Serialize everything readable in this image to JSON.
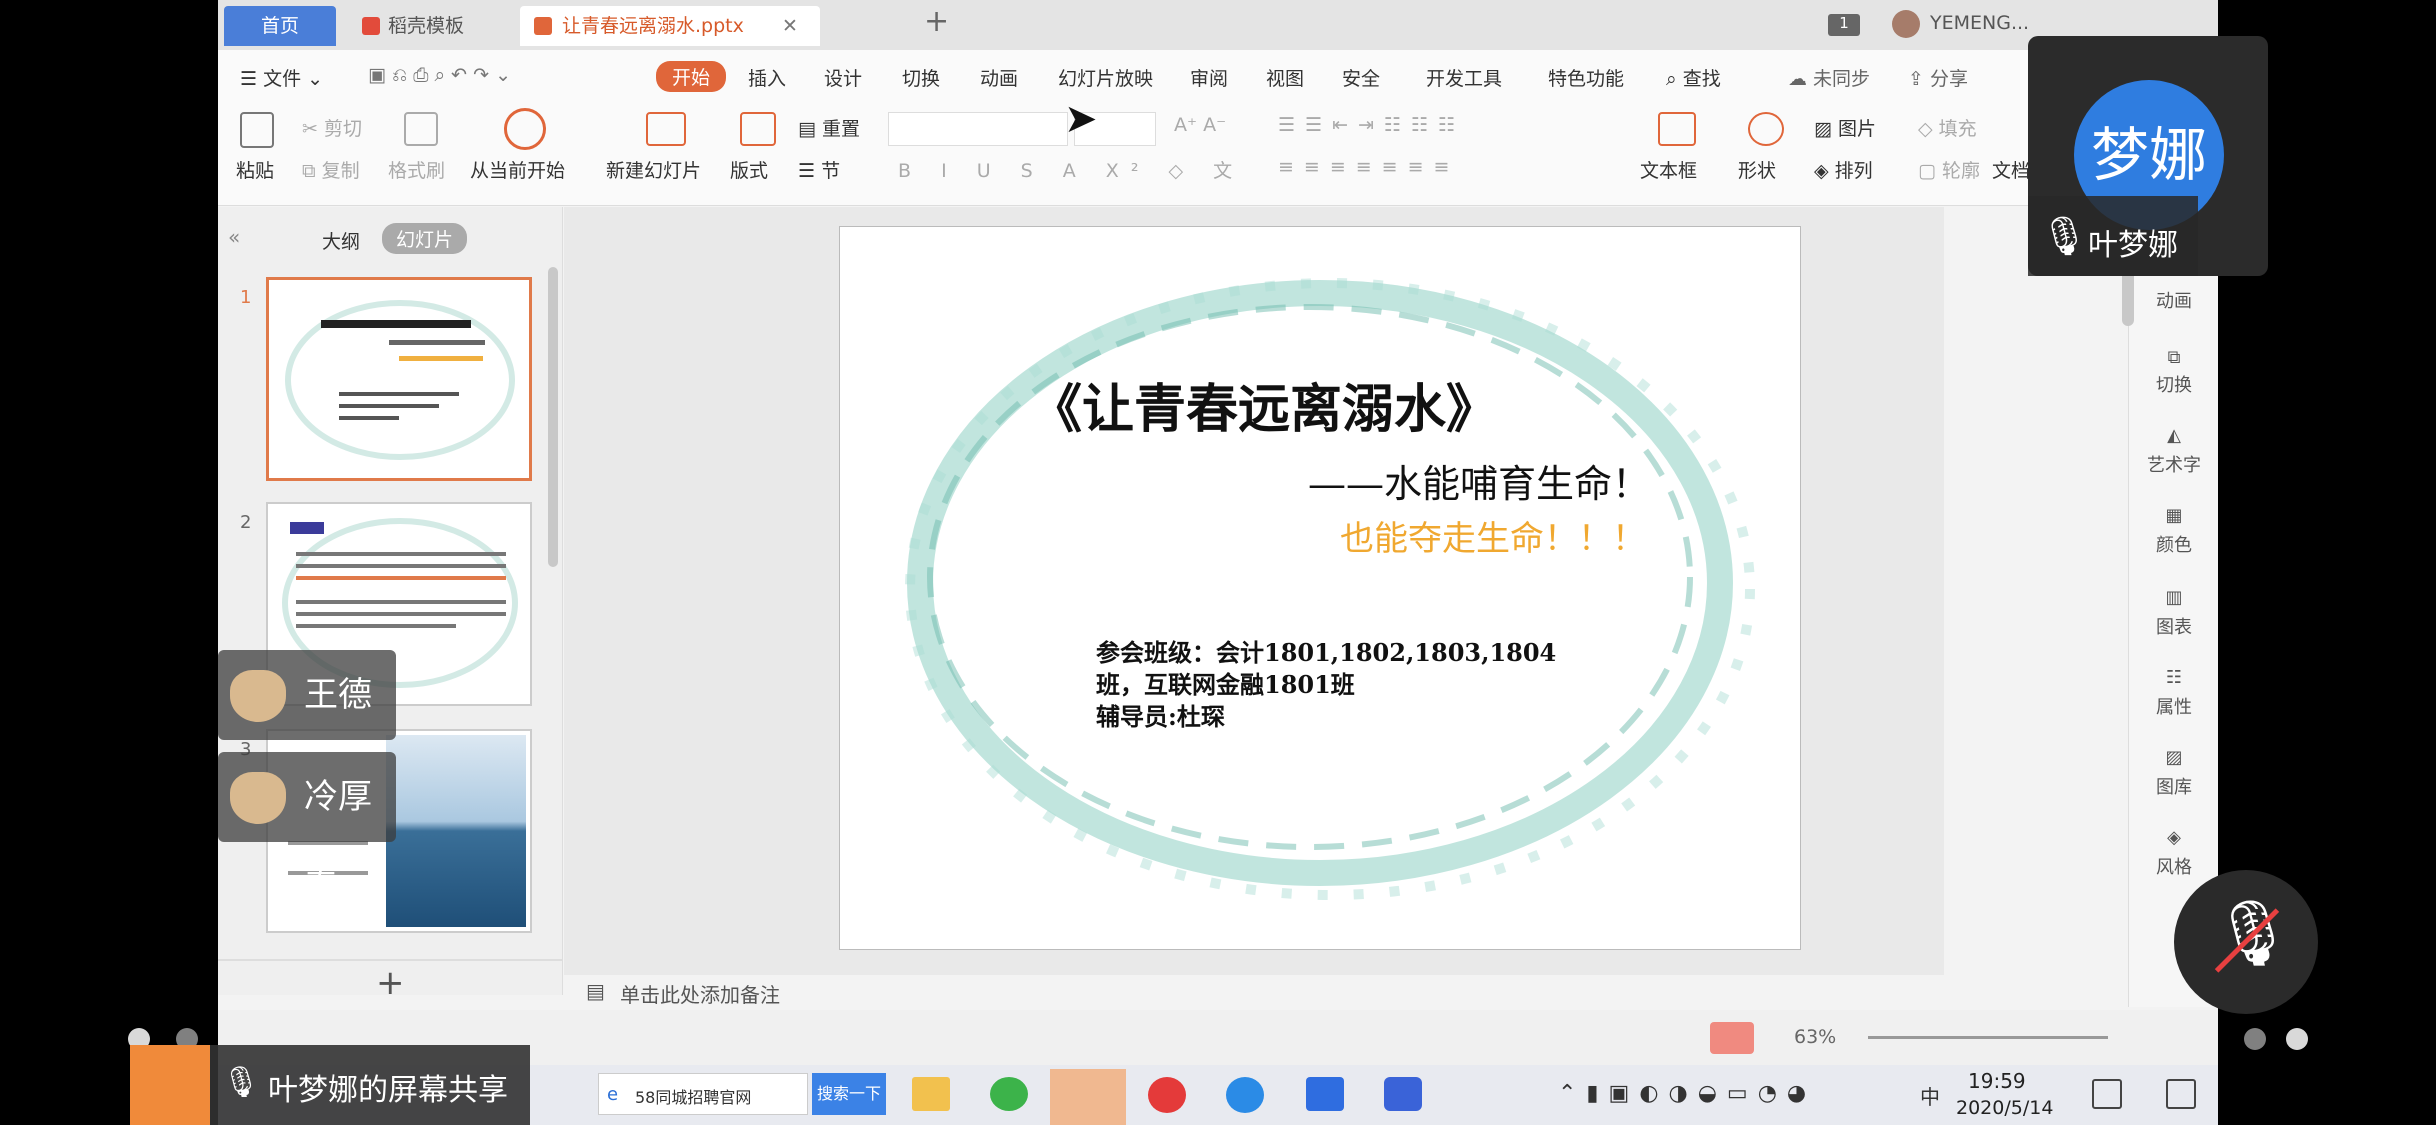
{
  "tabs": {
    "home": "首页",
    "templates": "稻壳模板",
    "document": "让青春远离溺水.pptx",
    "badge": "1",
    "user": "YEMENG..."
  },
  "menu": {
    "file": "文件",
    "start": "开始",
    "insert": "插入",
    "design": "设计",
    "transition": "切换",
    "animation": "动画",
    "slideshow": "幻灯片放映",
    "review": "审阅",
    "view": "视图",
    "security": "安全",
    "developer": "开发工具",
    "special": "特色功能",
    "search": "查找",
    "sync": "未同步",
    "share": "分享"
  },
  "ribbon": {
    "paste": "粘贴",
    "cut": "剪切",
    "copy": "复制",
    "format_painter": "格式刷",
    "from_current": "从当前开始",
    "new_slide": "新建幻灯片",
    "layout": "版式",
    "reset": "重置",
    "section": "节",
    "text_box": "文本框",
    "shape": "形状",
    "picture": "图片",
    "arrange": "排列",
    "fill": "填充",
    "outline": "轮廓",
    "doc": "文档"
  },
  "left_pane": {
    "outline": "大纲",
    "slides": "幻灯片",
    "nums": [
      "1",
      "2",
      "3"
    ]
  },
  "slide": {
    "title": "《让青春远离溺水》",
    "subtitle": "——水能哺育生命！",
    "subtitle2": "也能夺走生命！！！",
    "line1": "参会班级：会计1801,1802,1803,1804",
    "line2": "班，互联网金融1801班",
    "line3": "辅导员:杜琛"
  },
  "notes": "单击此处添加备注",
  "right_bar": [
    "动画",
    "切换",
    "艺术字",
    "颜色",
    "图表",
    "属性",
    "图库",
    "风格"
  ],
  "speaker": {
    "avatar": "梦娜",
    "name": "叶梦娜"
  },
  "participants": [
    "王德武",
    "冷厚春"
  ],
  "share_label": "叶梦娜的屏幕共享",
  "taskbar": {
    "browser_tab": "58同城招聘官网",
    "search_btn": "搜索一下",
    "time": "19:59",
    "date": "2020/5/14",
    "ime": "中"
  },
  "status": {
    "zoom": "63%"
  }
}
